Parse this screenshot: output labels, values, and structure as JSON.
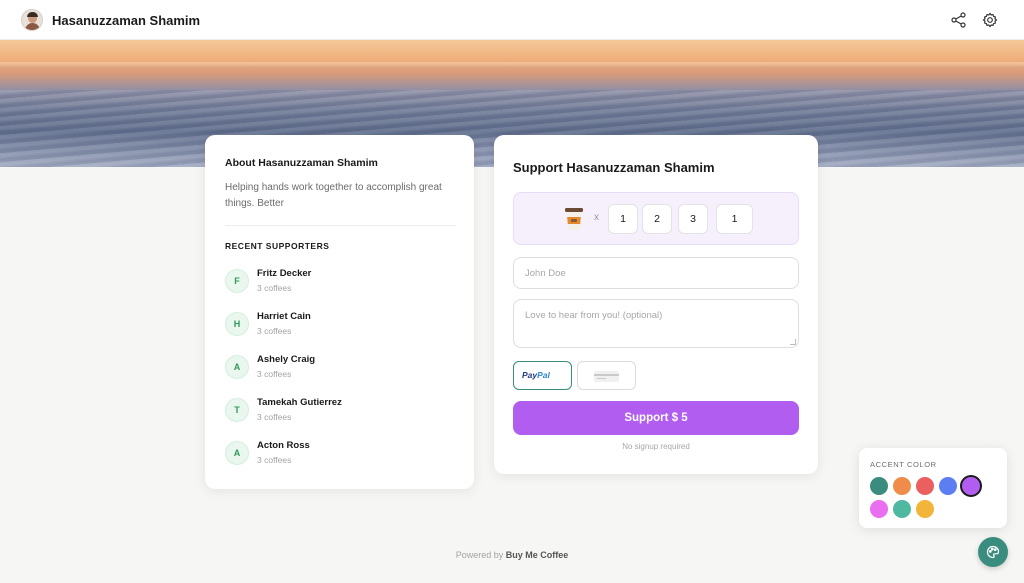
{
  "header": {
    "title": "Hasanuzzaman Shamim",
    "icons": [
      "share-icon",
      "gear-icon"
    ]
  },
  "about": {
    "title": "About Hasanuzzaman Shamim",
    "description": "Helping hands work together to accomplish great things. Better",
    "recent_title": "RECENT SUPPORTERS",
    "supporters": [
      {
        "initial": "F",
        "name": "Fritz Decker",
        "count": "3 coffees"
      },
      {
        "initial": "H",
        "name": "Harriet Cain",
        "count": "3 coffees"
      },
      {
        "initial": "A",
        "name": "Ashely Craig",
        "count": "3 coffees"
      },
      {
        "initial": "T",
        "name": "Tamekah Gutierrez",
        "count": "3 coffees"
      },
      {
        "initial": "A",
        "name": "Acton Ross",
        "count": "3 coffees"
      }
    ]
  },
  "support": {
    "title": "Support Hasanuzzaman Shamim",
    "coffee_icon": "coffee-cup-icon",
    "times": "x",
    "quantities": [
      "1",
      "2",
      "3"
    ],
    "quantity_value": "1",
    "name_placeholder": "John Doe",
    "message_placeholder": "Love to hear from you! (optional)",
    "paypal_p": "Pay",
    "paypal_pal": "Pal",
    "submit_label": "Support  $ 5",
    "note": "No signup required"
  },
  "accent": {
    "label": "ACCENT COLOR",
    "colors": [
      "#3a8d7e",
      "#ef8c4c",
      "#ec5f5f",
      "#5d7ef2",
      "#b05df0",
      "#ea6ef0",
      "#4fb8a0",
      "#f2b53a"
    ],
    "selected": "#b05df0"
  },
  "footer": {
    "prefix": "Powered by",
    "brand": "Buy Me Coffee"
  }
}
